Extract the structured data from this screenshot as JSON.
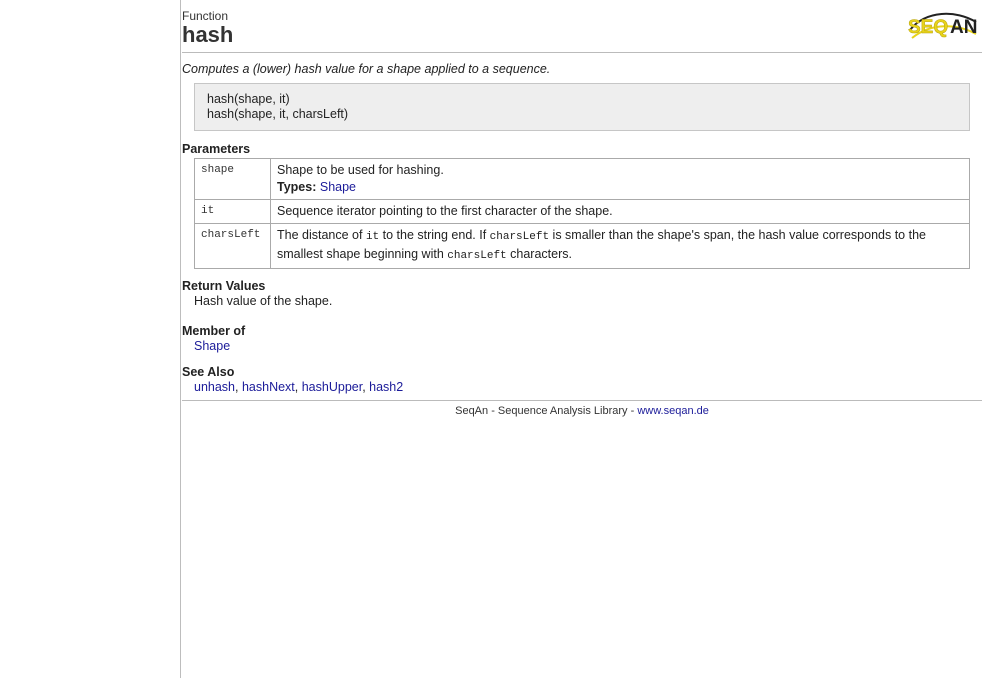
{
  "header": {
    "kind": "Function",
    "title": "hash",
    "logo": {
      "name": "seqan-logo-icon",
      "text": "SEQAN",
      "accent": "#e8d31a",
      "dark": "#222222"
    }
  },
  "description": "Computes a (lower) hash value for a shape applied to a sequence.",
  "signatures": [
    "hash(shape, it)",
    "hash(shape, it, charsLeft)"
  ],
  "parameters": {
    "heading": "Parameters",
    "rows": [
      {
        "name": "shape",
        "description": "Shape to be used for hashing.",
        "types_label": "Types:",
        "types_link": "Shape"
      },
      {
        "name": "it",
        "description": "Sequence iterator pointing to the first character of the shape."
      },
      {
        "name": "charsLeft",
        "desc_parts": [
          "The distance of ",
          "it",
          " to the string end. If ",
          "charsLeft",
          " is smaller than the shape's span, the hash value corresponds to the smallest shape beginning with ",
          "charsLeft",
          " characters."
        ]
      }
    ]
  },
  "return_values": {
    "heading": "Return Values",
    "text": "Hash value of the shape."
  },
  "member_of": {
    "heading": "Member of",
    "link": "Shape"
  },
  "see_also": {
    "heading": "See Also",
    "links": [
      "unhash",
      "hashNext",
      "hashUpper",
      "hash2"
    ],
    "separator": ", "
  },
  "footer": {
    "text": "SeqAn - Sequence Analysis Library - ",
    "link": "www.seqan.de"
  },
  "colors": {
    "link": "#1b1b99",
    "sigbox_bg": "#eeeeee",
    "rule": "#bbbbbb"
  }
}
